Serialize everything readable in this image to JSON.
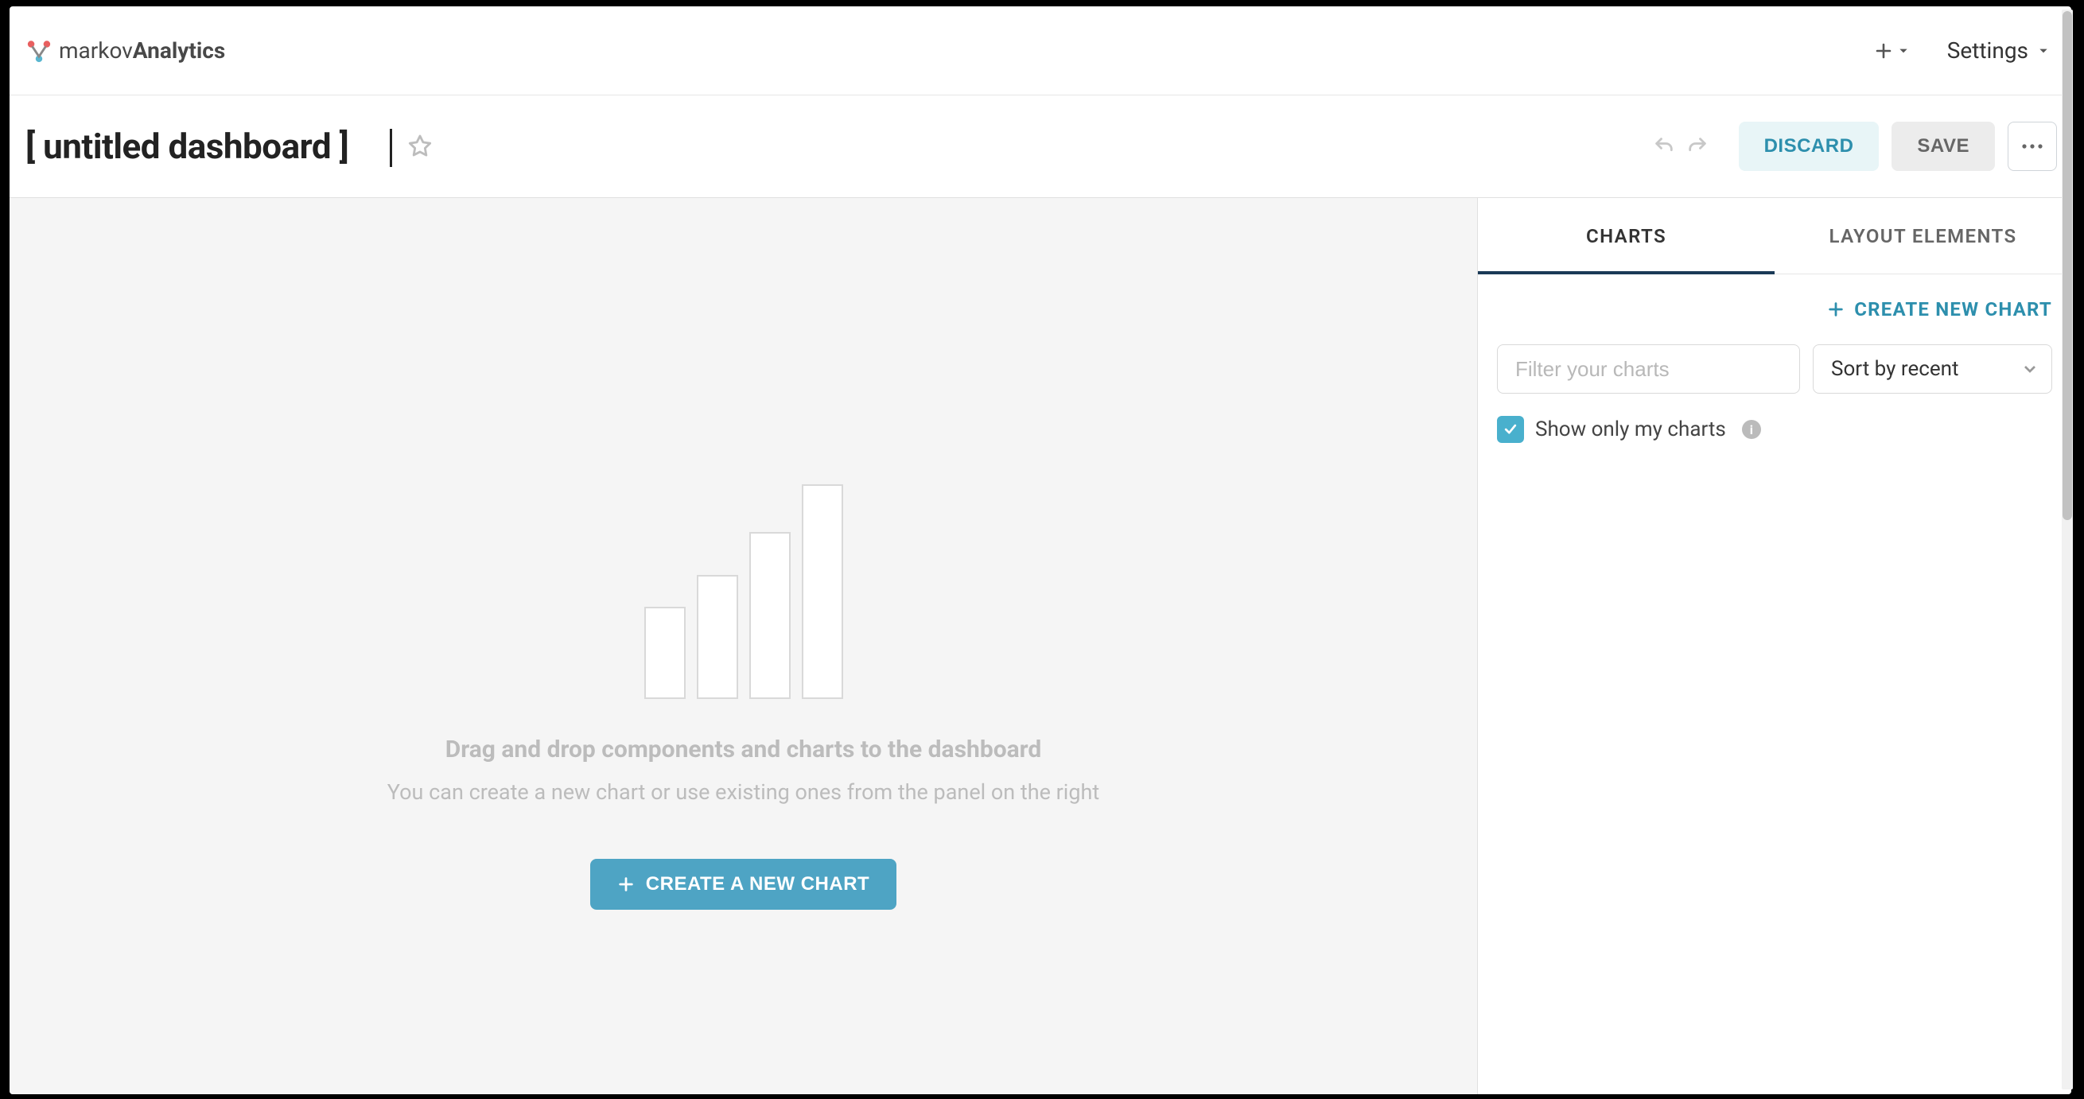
{
  "brand": {
    "light": "markov",
    "bold": "Analytics"
  },
  "topbar": {
    "settings_label": "Settings"
  },
  "editor": {
    "title": "[ untitled dashboard ]",
    "discard_label": "DISCARD",
    "save_label": "SAVE"
  },
  "canvas": {
    "empty_title": "Drag and drop components and charts to the dashboard",
    "empty_sub": "You can create a new chart or use existing ones from the panel on the right",
    "create_chart_label": "CREATE A NEW CHART"
  },
  "sidepanel": {
    "tabs": {
      "charts": "CHARTS",
      "layout": "LAYOUT ELEMENTS"
    },
    "create_new_chart": "CREATE NEW CHART",
    "filter_placeholder": "Filter your charts",
    "sort_label": "Sort by recent",
    "show_only_mine": "Show only my charts",
    "show_only_mine_checked": true
  }
}
